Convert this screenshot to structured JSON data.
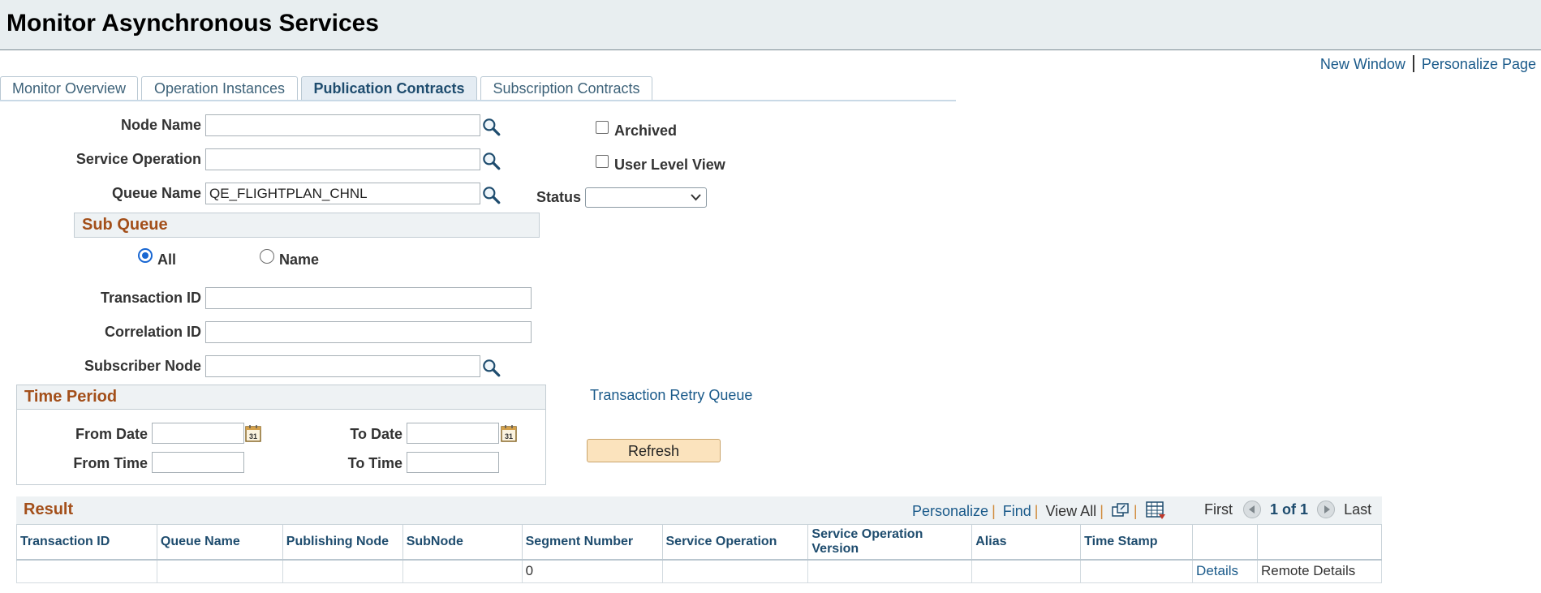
{
  "page": {
    "title": "Monitor Asynchronous Services"
  },
  "top_links": {
    "new_window": "New Window",
    "personalize_page": "Personalize Page"
  },
  "tabs": [
    {
      "label": "Monitor Overview",
      "active": false
    },
    {
      "label": "Operation Instances",
      "active": false
    },
    {
      "label": "Publication Contracts",
      "active": true
    },
    {
      "label": "Subscription Contracts",
      "active": false
    }
  ],
  "filters": {
    "node_name": {
      "label": "Node Name",
      "value": ""
    },
    "service_operation": {
      "label": "Service Operation",
      "value": ""
    },
    "queue_name": {
      "label": "Queue Name",
      "value": "QE_FLIGHTPLAN_CHNL"
    },
    "archived": {
      "label": "Archived",
      "checked": false
    },
    "user_level_view": {
      "label": "User Level View",
      "checked": false
    },
    "status": {
      "label": "Status",
      "value": ""
    }
  },
  "sub_queue": {
    "title": "Sub Queue",
    "options": [
      {
        "label": "All",
        "selected": true
      },
      {
        "label": "Name",
        "selected": false
      }
    ]
  },
  "transaction_id": {
    "label": "Transaction ID",
    "value": ""
  },
  "correlation_id": {
    "label": "Correlation ID",
    "value": ""
  },
  "subscriber_node": {
    "label": "Subscriber Node",
    "value": ""
  },
  "time_period": {
    "title": "Time Period",
    "from_date": {
      "label": "From Date",
      "value": ""
    },
    "to_date": {
      "label": "To Date",
      "value": ""
    },
    "from_time": {
      "label": "From Time",
      "value": ""
    },
    "to_time": {
      "label": "To Time",
      "value": ""
    }
  },
  "transaction_retry_queue": "Transaction Retry Queue",
  "refresh_label": "Refresh",
  "result": {
    "title": "Result",
    "nav": {
      "personalize": "Personalize",
      "find": "Find",
      "view_all": "View All",
      "first": "First",
      "page_info": "1 of 1",
      "last": "Last"
    },
    "columns": [
      "Transaction ID",
      "Queue Name",
      "Publishing Node",
      "SubNode",
      "Segment Number",
      "Service Operation",
      "Service Operation Version",
      "Alias",
      "Time Stamp",
      "",
      ""
    ],
    "rows": [
      {
        "transaction_id": "",
        "queue_name": "",
        "publishing_node": "",
        "subnode": "",
        "segment_number": "0",
        "service_operation": "",
        "service_operation_version": "",
        "alias": "",
        "time_stamp": "",
        "details": "Details",
        "remote_details": "Remote Details"
      }
    ]
  },
  "colors": {
    "accent_title": "#a34f1a",
    "link": "#1a5a8a",
    "button": "#fbe3bd"
  }
}
